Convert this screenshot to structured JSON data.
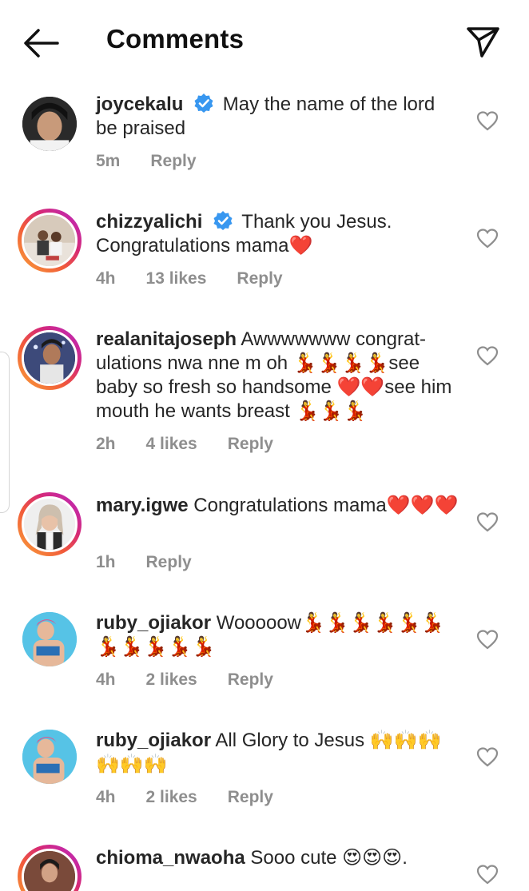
{
  "header": {
    "title": "Comments",
    "back_icon": "arrow-left-icon",
    "send_icon": "paper-plane-icon"
  },
  "comments": [
    {
      "username": "joycekalu",
      "verified": true,
      "text": "May the name of the lord be praised",
      "time": "5m",
      "likes": "",
      "reply": "Reply"
    },
    {
      "username": "chizzyalichi",
      "verified": true,
      "text": "Thank you Jesus. Congratulations mama❤️",
      "time": "4h",
      "likes": "13 likes",
      "reply": "Reply"
    },
    {
      "username": "realanitajoseph",
      "verified": false,
      "text": "Awwwwwww congrat-ulations nwa nne m oh 💃💃💃💃see baby so fresh so handsome ❤️❤️see him mouth he wants breast 💃💃💃",
      "time": "2h",
      "likes": "4 likes",
      "reply": "Reply"
    },
    {
      "username": "mary.igwe",
      "verified": false,
      "text": "Congratulations mama❤️❤️❤️",
      "time": "1h",
      "likes": "",
      "reply": "Reply"
    },
    {
      "username": "ruby_ojiakor",
      "verified": false,
      "text": "Wooooow💃💃💃💃💃💃💃💃💃💃💃",
      "time": "4h",
      "likes": "2 likes",
      "reply": "Reply"
    },
    {
      "username": "ruby_ojiakor",
      "verified": false,
      "text": "All Glory to Jesus 🙌🙌🙌🙌🙌🙌",
      "time": "4h",
      "likes": "2 likes",
      "reply": "Reply"
    },
    {
      "username": "chioma_nwaoha",
      "verified": false,
      "text": "Sooo cute 😍😍😍.",
      "time": "",
      "likes": "",
      "reply": ""
    }
  ],
  "colors": {
    "verified": "#3897f0",
    "meta": "#8e8e8e",
    "text": "#262626"
  }
}
